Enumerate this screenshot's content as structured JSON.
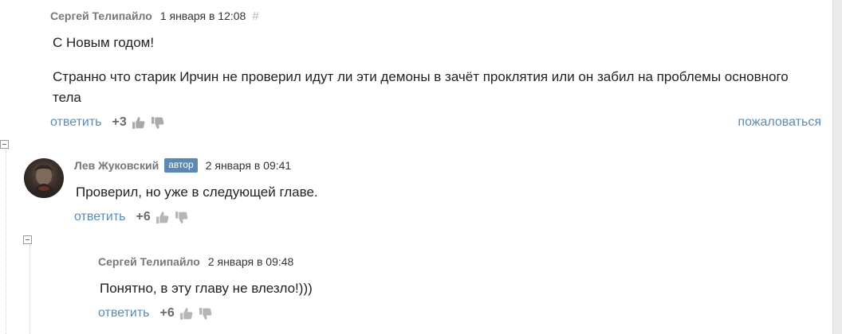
{
  "comments": [
    {
      "author": "Сергей Телипайло",
      "date": "1 января в 12:08",
      "hash": "#",
      "text": [
        "С Новым годом!",
        "Странно что старик Ирчин не проверил идут ли эти демоны в зачёт проклятия или он забил на проблемы основного тела"
      ],
      "reply_label": "ответить",
      "score": "+3",
      "report_label": "пожаловаться"
    },
    {
      "author": "Лев Жуковский",
      "badge": "автор",
      "date": "2 января в 09:41",
      "text": [
        "Проверил, но уже в следующей главе."
      ],
      "reply_label": "ответить",
      "score": "+6"
    },
    {
      "author": "Сергей Телипайло",
      "date": "2 января в 09:48",
      "text": [
        "Понятно, в эту главу не влезло!)))"
      ],
      "reply_label": "ответить",
      "score": "+6"
    }
  ],
  "colors": {
    "link": "#5b8bb5",
    "badge": "#5b89b2",
    "author": "#777777",
    "score": "#6b6b6b",
    "vote_icon": "#a9a9a9"
  },
  "icons": [
    "thumbs-up-icon",
    "thumbs-down-icon",
    "collapse-icon",
    "avatar"
  ]
}
